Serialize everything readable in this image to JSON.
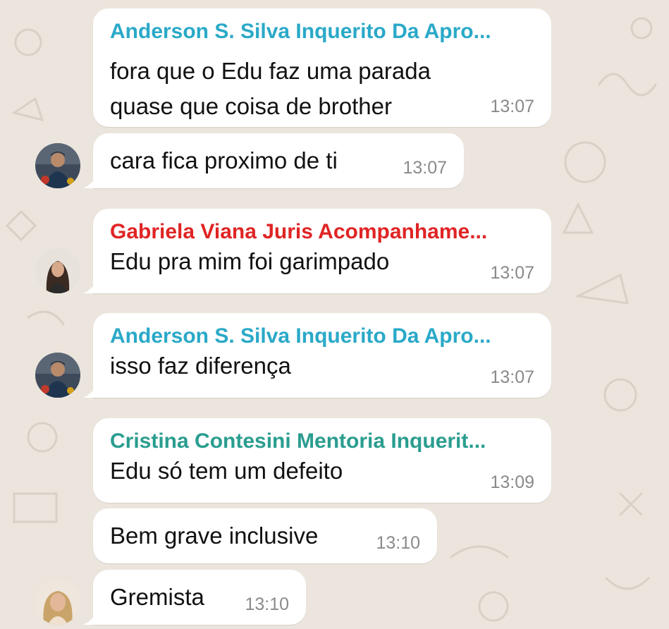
{
  "colors": {
    "background": "#ece5dd",
    "bubble": "#ffffff",
    "timestamp": "#8a8a8a",
    "message_text": "#111111",
    "sender_teal": "#2aa9c8",
    "sender_red": "#e02424",
    "sender_green": "#2a9d8f"
  },
  "chat": {
    "messages": [
      {
        "sender": "Anderson S. Silva Inquerito Da Apro...",
        "sender_color": "#2aa9c8",
        "lines": [
          "fora que o Edu faz uma parada",
          "quase que coisa de brother"
        ],
        "time": "13:07"
      },
      {
        "lines": [
          "cara fica proximo de ti"
        ],
        "time": "13:07",
        "avatar": "avatar-man-icon"
      },
      {
        "sender": "Gabriela Viana Juris Acompanhame...",
        "sender_color": "#e02424",
        "lines": [
          "Edu pra mim foi garimpado"
        ],
        "time": "13:07",
        "avatar": "avatar-woman-dark-hair-icon"
      },
      {
        "sender": "Anderson S. Silva Inquerito Da Apro...",
        "sender_color": "#2aa9c8",
        "lines": [
          "isso faz diferença"
        ],
        "time": "13:07",
        "avatar": "avatar-man-icon"
      },
      {
        "sender": "Cristina Contesini Mentoria Inquerit...",
        "sender_color": "#2a9d8f",
        "lines": [
          "Edu só tem um defeito"
        ],
        "time": "13:09"
      },
      {
        "lines": [
          "Bem grave inclusive"
        ],
        "time": "13:10"
      },
      {
        "lines": [
          "Gremista"
        ],
        "time": "13:10",
        "avatar": "avatar-woman-blonde-icon"
      }
    ]
  }
}
